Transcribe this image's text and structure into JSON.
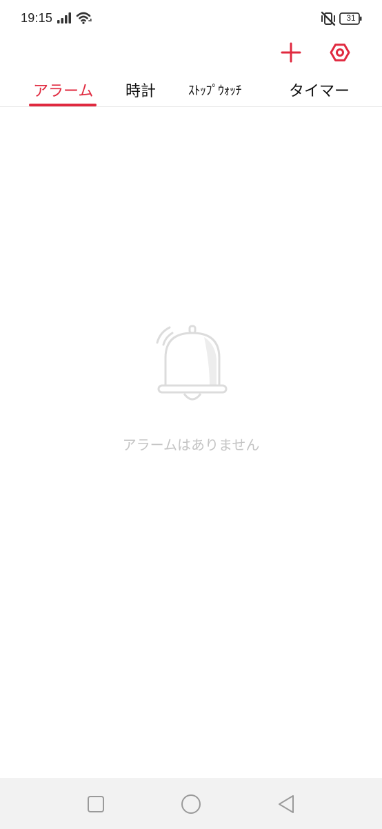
{
  "status_bar": {
    "time": "19:15",
    "battery_level": "31",
    "icons": [
      "signal-icon",
      "wifi-icon",
      "vibrate-silent-icon",
      "battery-icon"
    ]
  },
  "toolbar": {
    "add_icon": "plus-icon",
    "settings_icon": "settings-icon"
  },
  "tabs": [
    {
      "label": "アラーム",
      "active": true
    },
    {
      "label": "時計",
      "active": false
    },
    {
      "label": "ｽﾄｯﾌﾟｳｫｯﾁ",
      "active": false
    },
    {
      "label": "タイマー",
      "active": false
    }
  ],
  "empty_state": {
    "icon": "bell-icon",
    "message": "アラームはありません"
  },
  "nav_bar": {
    "icons": [
      "recent-apps-icon",
      "home-icon",
      "back-icon"
    ]
  },
  "colors": {
    "accent": "#e0293f",
    "empty_text": "#c4c4c4",
    "nav_bar_bg": "#f2f2f2"
  }
}
